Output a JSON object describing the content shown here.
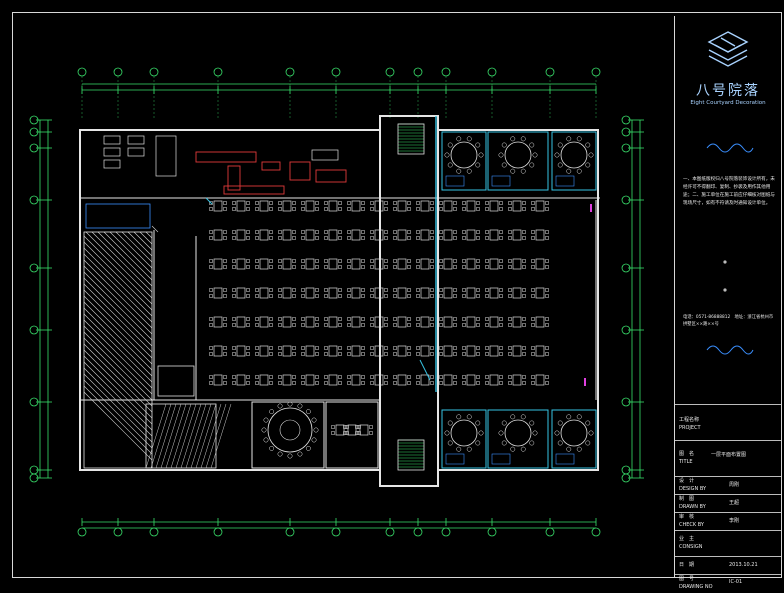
{
  "title_block": {
    "brand_cn": "八号院落",
    "brand_en": "Eight Courtyard Decoration",
    "note": "一、本图纸版权归八号院落装饰设计所有，未经许可不得翻印、复制、抄袭及用作其他用途；二、施工单位在施工前应仔细核对图纸与现场尺寸，如有不符请及时通知设计单位。",
    "contact": "电话：0571-86888812　地址：浙江省杭州市拱墅区××路××号",
    "project_label": "工程名称",
    "project_label_en": "PROJECT",
    "title_label": "图　名",
    "title_label_en": "TITLE",
    "title_value": "一层平面布置图",
    "design_label": "设　计",
    "design_label_en": "DESIGN BY",
    "design_value": "周刚",
    "drawn_label": "制　图",
    "drawn_label_en": "DRAWN BY",
    "drawn_value": "王超",
    "check_label": "审　核",
    "check_label_en": "CHECK BY",
    "check_value": "李刚",
    "consign_label": "业　主",
    "consign_label_en": "CONSIGN",
    "date_label": "日　期",
    "date_value": "2013.10.21",
    "drawing_no_label": "图　号",
    "drawing_no_label_en": "DRAWING NO",
    "drawing_no_value": "IC-01"
  },
  "colors": {
    "wall": "#e6e6e6",
    "dim": "#39e06b",
    "axis": "#39e06b",
    "cyan": "#36c4e4",
    "red": "#e03a3a",
    "magenta": "#e040e0",
    "blue": "#3a8fff"
  }
}
